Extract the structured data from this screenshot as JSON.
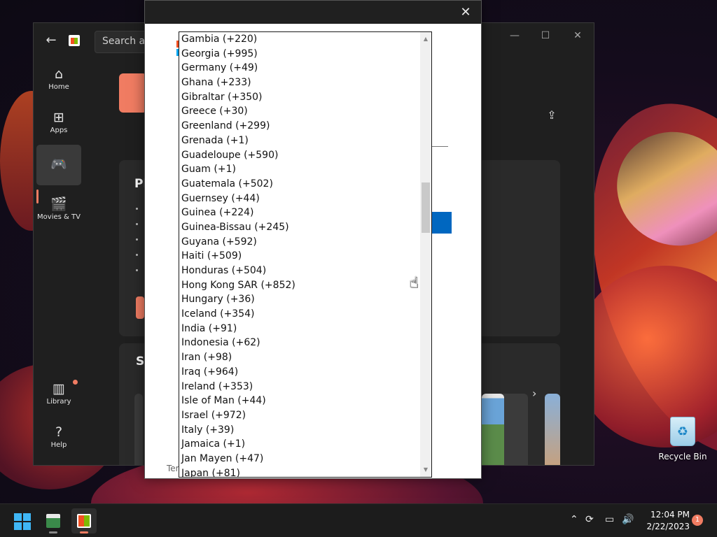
{
  "store": {
    "search_placeholder": "Search ap",
    "nav": [
      {
        "label": "Home",
        "icon": "home-icon"
      },
      {
        "label": "Apps",
        "icon": "apps-icon"
      },
      {
        "label": "",
        "icon": "gaming-icon"
      },
      {
        "label": "Movies & TV",
        "icon": "movies-icon"
      },
      {
        "label": "Library",
        "icon": "library-icon"
      },
      {
        "label": "Help",
        "icon": "help-icon"
      }
    ],
    "panel_title_partial": "Pl",
    "section_title_partial": "So",
    "footer_partial": "Ter"
  },
  "dialog": {
    "close_icon": "close-icon"
  },
  "country_list": {
    "options": [
      "Gambia (+220)",
      "Georgia (+995)",
      "Germany (+49)",
      "Ghana (+233)",
      "Gibraltar (+350)",
      "Greece (+30)",
      "Greenland (+299)",
      "Grenada (+1)",
      "Guadeloupe (+590)",
      "Guam (+1)",
      "Guatemala (+502)",
      "Guernsey (+44)",
      "Guinea (+224)",
      "Guinea-Bissau (+245)",
      "Guyana (+592)",
      "Haiti (+509)",
      "Honduras (+504)",
      "Hong Kong SAR (+852)",
      "Hungary (+36)",
      "Iceland (+354)",
      "India (+91)",
      "Indonesia (+62)",
      "Iran (+98)",
      "Iraq (+964)",
      "Ireland (+353)",
      "Isle of Man (+44)",
      "Israel (+972)",
      "Italy (+39)",
      "Jamaica (+1)",
      "Jan Mayen (+47)",
      "Japan (+81)"
    ]
  },
  "desktop": {
    "recycle_bin_label": "Recycle Bin"
  },
  "taskbar": {
    "time": "12:04 PM",
    "date": "2/22/2023",
    "notification_count": "1"
  },
  "colors": {
    "accent": "#f07c62",
    "dialog_button": "#0067c0",
    "start_blue": "#3fb6f5"
  }
}
